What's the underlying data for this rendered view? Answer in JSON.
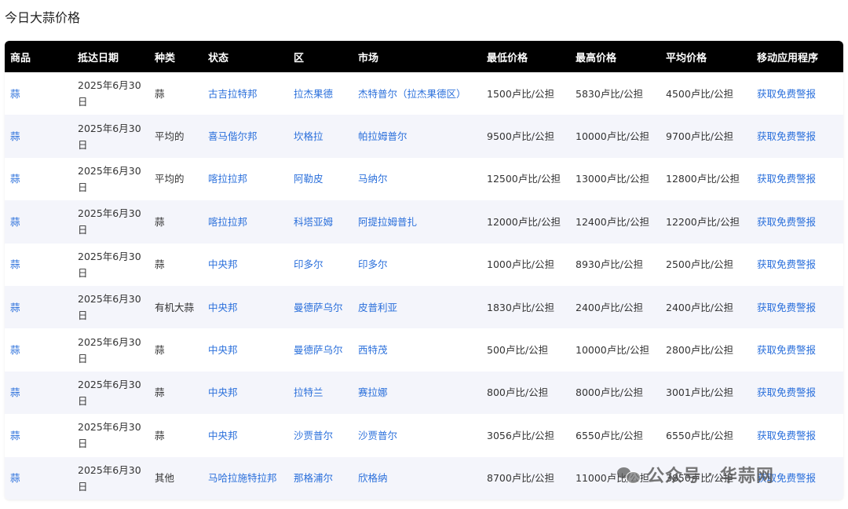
{
  "page": {
    "title": "今日大蒜价格"
  },
  "table": {
    "headers": [
      "商品",
      "抵达日期",
      "种类",
      "状态",
      "区",
      "市场",
      "最低价格",
      "最高价格",
      "平均价格",
      "移动应用程序"
    ],
    "rows": [
      [
        "蒜",
        "2025年6月30日",
        "蒜",
        "古吉拉特邦",
        "拉杰果德",
        "杰特普尔（拉杰果德区）",
        "1500卢比/公担",
        "5830卢比/公担",
        "4500卢比/公担",
        "获取免费警报"
      ],
      [
        "蒜",
        "2025年6月30日",
        "平均的",
        "喜马偕尔邦",
        "坎格拉",
        "帕拉姆普尔",
        "9500卢比/公担",
        "10000卢比/公担",
        "9700卢比/公担",
        "获取免费警报"
      ],
      [
        "蒜",
        "2025年6月30日",
        "平均的",
        "喀拉拉邦",
        "阿勒皮",
        "马纳尔",
        "12500卢比/公担",
        "13000卢比/公担",
        "12800卢比/公担",
        "获取免费警报"
      ],
      [
        "蒜",
        "2025年6月30日",
        "蒜",
        "喀拉拉邦",
        "科塔亚姆",
        "阿提拉姆普扎",
        "12000卢比/公担",
        "12400卢比/公担",
        "12200卢比/公担",
        "获取免费警报"
      ],
      [
        "蒜",
        "2025年6月30日",
        "蒜",
        "中央邦",
        "印多尔",
        "印多尔",
        "1000卢比/公担",
        "8930卢比/公担",
        "2500卢比/公担",
        "获取免费警报"
      ],
      [
        "蒜",
        "2025年6月30日",
        "有机大蒜",
        "中央邦",
        "曼德萨乌尔",
        "皮普利亚",
        "1830卢比/公担",
        "2400卢比/公担",
        "2400卢比/公担",
        "获取免费警报"
      ],
      [
        "蒜",
        "2025年6月30日",
        "蒜",
        "中央邦",
        "曼德萨乌尔",
        "西特茂",
        "500卢比/公担",
        "10000卢比/公担",
        "2800卢比/公担",
        "获取免费警报"
      ],
      [
        "蒜",
        "2025年6月30日",
        "蒜",
        "中央邦",
        "拉特兰",
        "赛拉娜",
        "800卢比/公担",
        "8000卢比/公担",
        "3001卢比/公担",
        "获取免费警报"
      ],
      [
        "蒜",
        "2025年6月30日",
        "蒜",
        "中央邦",
        "沙贾普尔",
        "沙贾普尔",
        "3056卢比/公担",
        "6550卢比/公担",
        "6550卢比/公担",
        "获取免费警报"
      ],
      [
        "蒜",
        "2025年6月30日",
        "其他",
        "马哈拉施特拉邦",
        "那格浦尔",
        "欣格纳",
        "8700卢比/公担",
        "11000卢比/公担",
        "3850卢比/公担",
        "获取免费警报"
      ]
    ]
  },
  "watermark": {
    "icon": "wechat-icon",
    "text": "公众号",
    "separator": "·",
    "brand": "华蒜网"
  },
  "colors": {
    "header_bg": "#000000",
    "link": "#2a6fdb",
    "row_alt": "#f4f5fb"
  }
}
